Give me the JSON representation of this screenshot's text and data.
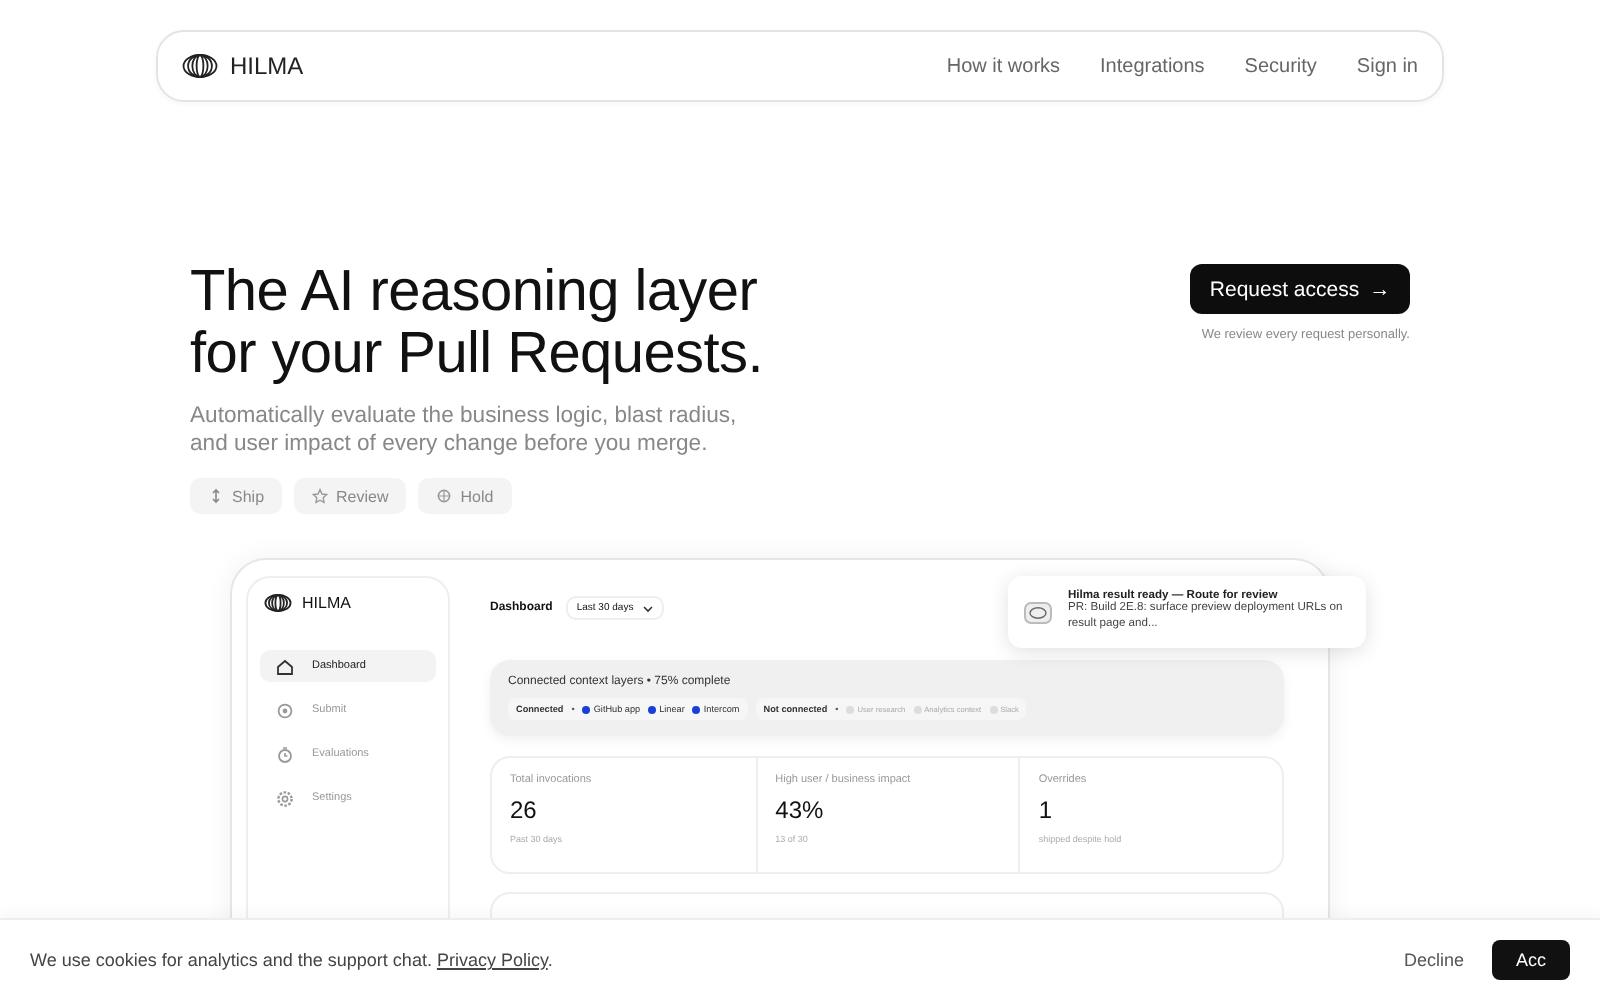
{
  "nav": {
    "brand": "HILMA",
    "links": [
      "How it works",
      "Integrations",
      "Security",
      "Sign in"
    ]
  },
  "hero": {
    "title_lines": [
      "The AI reasoning layer",
      "for your Pull Requests."
    ],
    "subtitle": "Automatically evaluate the business logic, blast radius, and user impact of every change before you merge.",
    "chips": [
      {
        "label": "Ship",
        "kind": "ship"
      },
      {
        "label": "Review",
        "kind": "review"
      },
      {
        "label": "Hold",
        "kind": "hold"
      }
    ],
    "cta": {
      "label": "Request access",
      "arrow": "→",
      "note": "We review every request personally."
    }
  },
  "dashboard": {
    "brand": "HILMA",
    "nav": [
      {
        "label": "Dashboard",
        "kind": "home",
        "selected": true
      },
      {
        "label": "Submit",
        "kind": "submit",
        "selected": false
      },
      {
        "label": "Evaluations",
        "kind": "clock",
        "selected": false
      },
      {
        "label": "Settings",
        "kind": "settings",
        "selected": false
      }
    ],
    "title": "Dashboard",
    "range": "Last 30 days",
    "context": {
      "title": "Connected context layers • 75% complete",
      "groups": [
        {
          "label": "Connected",
          "separator": "•",
          "connected": true,
          "items": [
            "GitHub app",
            "Linear",
            "Intercom"
          ]
        },
        {
          "label": "Not connected",
          "separator": "•",
          "connected": false,
          "items": [
            "User research",
            "Analytics context",
            "Slack"
          ]
        }
      ]
    },
    "stats": [
      {
        "label": "Total invocations",
        "value": "26",
        "note": "Past 30 days"
      },
      {
        "label": "High user / business impact",
        "value": "43%",
        "note": "13 of 30"
      },
      {
        "label": "Overrides",
        "value": "1",
        "note": "shipped despite hold"
      }
    ],
    "notification": {
      "title": "Hilma result ready — Route for review",
      "body": "PR: Build 2E.8: surface preview deployment URLs on result page and..."
    }
  },
  "cookie": {
    "text": "We use cookies for analytics and the support chat.",
    "link": "Privacy Policy",
    "end": ".",
    "buttons": [
      "Decline",
      "Acc"
    ]
  }
}
